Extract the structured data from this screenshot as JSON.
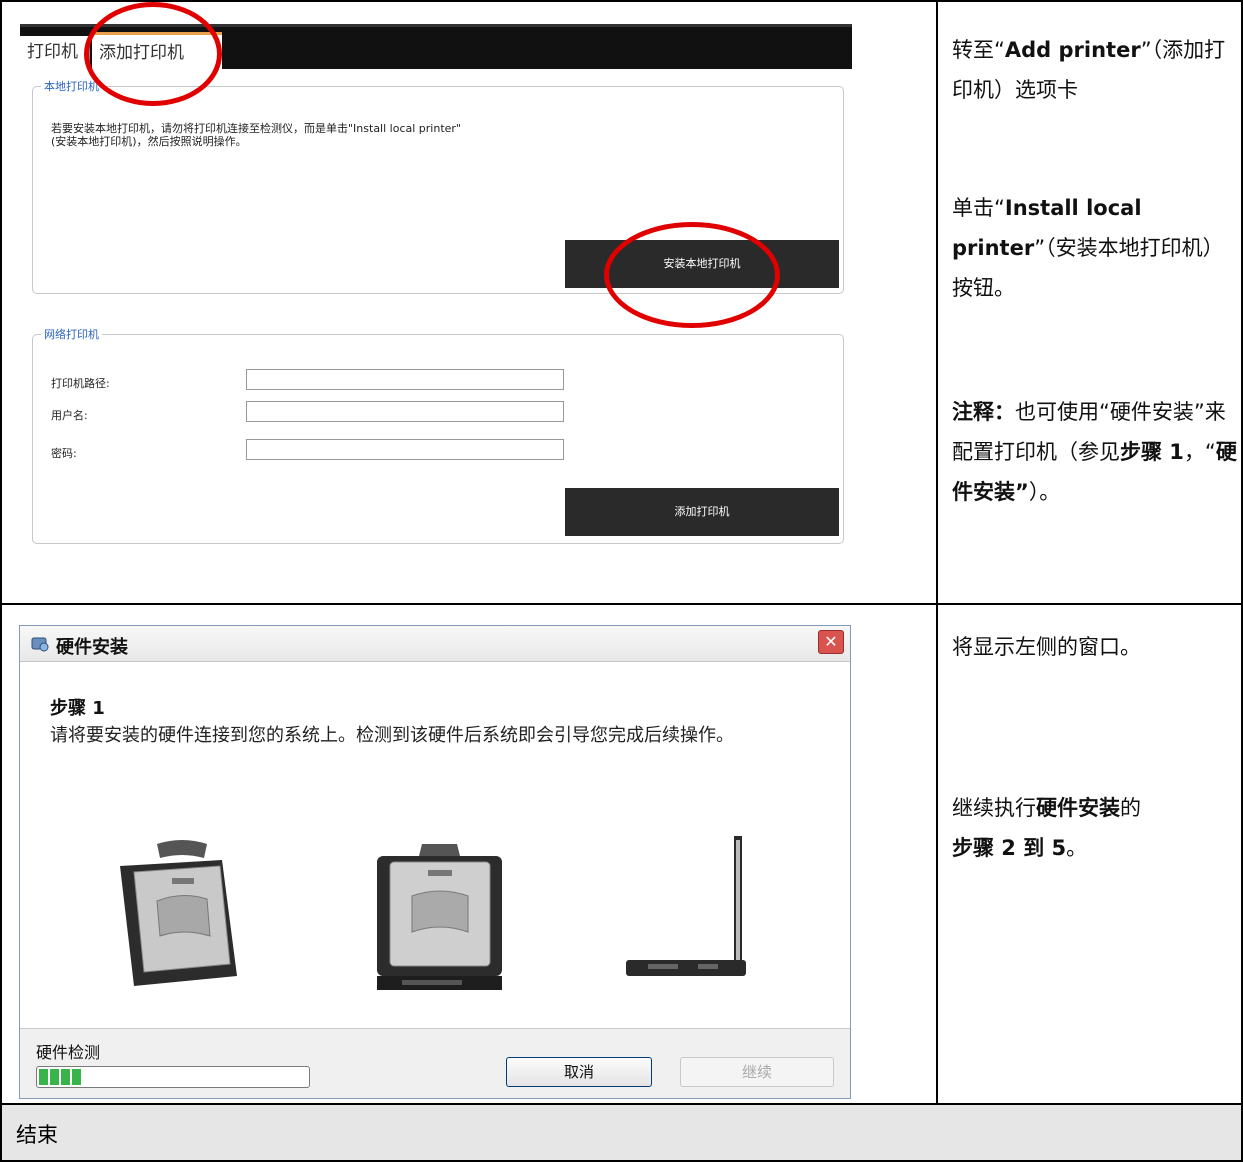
{
  "printer_page": {
    "tabs": [
      "打印机",
      "添加打印机"
    ],
    "local_group": {
      "legend": "本地打印机",
      "description": "若要安装本地打印机，请勿将打印机连接至检测仪，而是单击\"Install local printer\"(安装本地打印机)，然后按照说明操作。",
      "button": "安装本地打印机"
    },
    "network_group": {
      "legend": "网络打印机",
      "fields": [
        "打印机路径:",
        "用户名:",
        "密码:"
      ],
      "button": "添加打印机"
    }
  },
  "instructions_1": {
    "line1_pre": "转至“",
    "line1_bold": "Add printer",
    "line1_post": "”（添加打印机）选项卡",
    "line2_pre": "单击“",
    "line2_bold": "Install local printer",
    "line2_post": "”（安装本地打印机）按钮。",
    "note_label": "注释：",
    "note_pre": "也可使用“硬件安装”来配置打印机（参见",
    "note_step": "步骤 1",
    "note_mid": "，“",
    "note_bold": "硬件安装”",
    "note_post": "）。"
  },
  "hardware_dialog": {
    "title": "硬件安装",
    "step_title": "步骤 1",
    "step_desc": "请将要安装的硬件连接到您的系统上。检测到该硬件后系统即会引导您完成后续操作。",
    "detect_label": "硬件检测",
    "progress_segments": 4,
    "cancel": "取消",
    "continue": "继续"
  },
  "instructions_2": {
    "line1": "将显示左侧的窗口。",
    "line2_pre": "继续执行",
    "line2_bold": "硬件安装",
    "line2_post": "的",
    "line3_bold": "步骤 2 到 5",
    "line3_post": "。"
  },
  "end_text": "结束",
  "colors": {
    "highlight_ring": "#e00000",
    "tab_accent": "#e8a24d",
    "legend_blue": "#2a63c0"
  }
}
